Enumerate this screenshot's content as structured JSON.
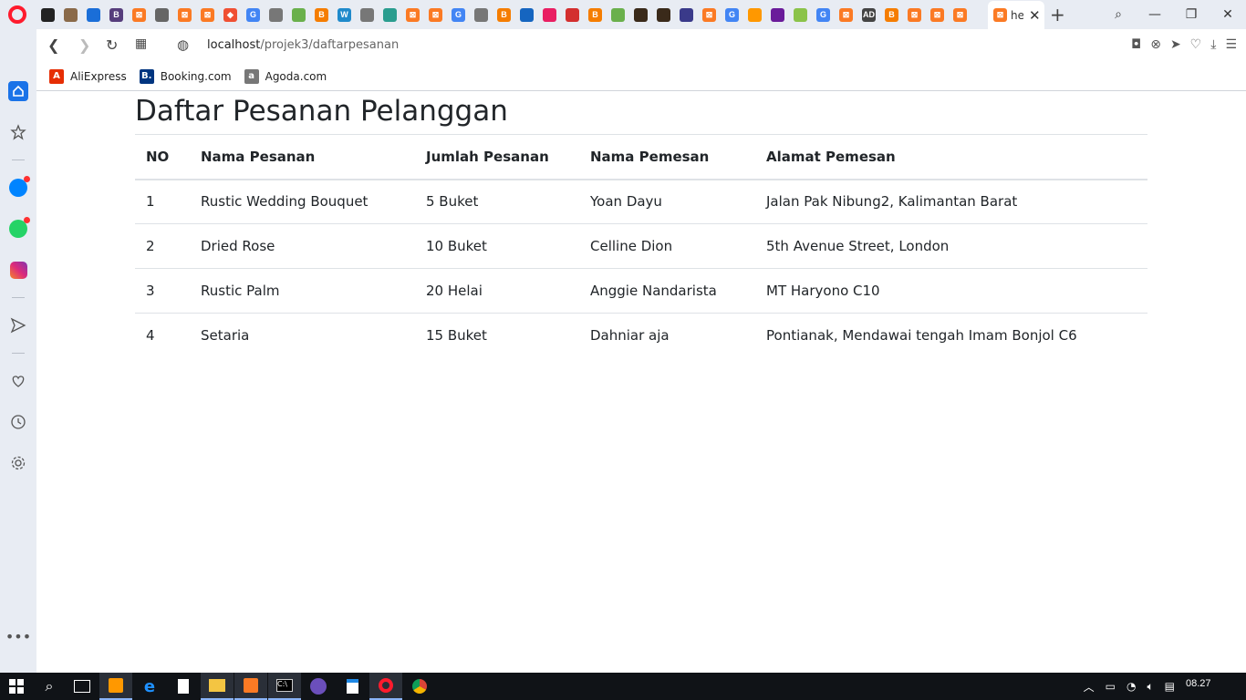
{
  "browser": {
    "active_tab_title": "he",
    "url_host": "localhost",
    "url_path": "/projek3/daftarpesanan",
    "tab_favicons": [
      {
        "name": "github-icon",
        "color": "#222",
        "glyph": ""
      },
      {
        "name": "avatar-icon",
        "color": "#8a6a4a",
        "glyph": ""
      },
      {
        "name": "flag-icon",
        "color": "#1a6ed8",
        "glyph": ""
      },
      {
        "name": "bootstrap-icon",
        "color": "#563d7c",
        "glyph": "B"
      },
      {
        "name": "xampp-icon",
        "color": "#fb7a24",
        "glyph": "⊠"
      },
      {
        "name": "grid-icon",
        "color": "#666",
        "glyph": ""
      },
      {
        "name": "xampp-icon",
        "color": "#fb7a24",
        "glyph": "⊠"
      },
      {
        "name": "xampp-icon",
        "color": "#fb7a24",
        "glyph": "⊠"
      },
      {
        "name": "git-icon",
        "color": "#f05033",
        "glyph": "◆"
      },
      {
        "name": "google-icon",
        "color": "#4285f4",
        "glyph": "G"
      },
      {
        "name": "doc-icon",
        "color": "#777",
        "glyph": ""
      },
      {
        "name": "leaf-icon",
        "color": "#6ab04c",
        "glyph": ""
      },
      {
        "name": "blogger-icon",
        "color": "#f57d00",
        "glyph": "B"
      },
      {
        "name": "w-icon",
        "color": "#1f8acb",
        "glyph": "W"
      },
      {
        "name": "doc-icon",
        "color": "#777",
        "glyph": ""
      },
      {
        "name": "pen-icon",
        "color": "#2a9d8f",
        "glyph": ""
      },
      {
        "name": "xampp-icon",
        "color": "#fb7a24",
        "glyph": "⊠"
      },
      {
        "name": "xampp-icon",
        "color": "#fb7a24",
        "glyph": "⊠"
      },
      {
        "name": "google-icon",
        "color": "#4285f4",
        "glyph": "G"
      },
      {
        "name": "doc-icon",
        "color": "#777",
        "glyph": ""
      },
      {
        "name": "blogger-icon",
        "color": "#f57d00",
        "glyph": "B"
      },
      {
        "name": "wave-icon",
        "color": "#1565c0",
        "glyph": ""
      },
      {
        "name": "color-icon",
        "color": "#e91e63",
        "glyph": ""
      },
      {
        "name": "record-icon",
        "color": "#d32f2f",
        "glyph": ""
      },
      {
        "name": "blogger-icon",
        "color": "#f57d00",
        "glyph": "B"
      },
      {
        "name": "leaf-icon",
        "color": "#6ab04c",
        "glyph": ""
      },
      {
        "name": "dark-icon",
        "color": "#3a2a1a",
        "glyph": ""
      },
      {
        "name": "dark-icon",
        "color": "#3a2a1a",
        "glyph": ""
      },
      {
        "name": "game-icon",
        "color": "#3a3a8a",
        "glyph": ""
      },
      {
        "name": "xampp-icon",
        "color": "#fb7a24",
        "glyph": "⊠"
      },
      {
        "name": "google-icon",
        "color": "#4285f4",
        "glyph": "G"
      },
      {
        "name": "note-icon",
        "color": "#ff9800",
        "glyph": ""
      },
      {
        "name": "colorlib-icon",
        "color": "#6a1b9a",
        "glyph": ""
      },
      {
        "name": "seal-icon",
        "color": "#8bc34a",
        "glyph": ""
      },
      {
        "name": "google-icon",
        "color": "#4285f4",
        "glyph": "G"
      },
      {
        "name": "xampp-icon",
        "color": "#fb7a24",
        "glyph": "⊠"
      },
      {
        "name": "ad-icon",
        "color": "#444",
        "glyph": "AD"
      },
      {
        "name": "blogger-icon",
        "color": "#f57d00",
        "glyph": "B"
      },
      {
        "name": "xampp-icon",
        "color": "#fb7a24",
        "glyph": "⊠"
      },
      {
        "name": "xampp-icon",
        "color": "#fb7a24",
        "glyph": "⊠"
      },
      {
        "name": "xampp-icon",
        "color": "#fb7a24",
        "glyph": "⊠"
      }
    ],
    "bookmarks": [
      {
        "label": "AliExpress",
        "icon": "aliexpress-icon",
        "color": "#e62e04",
        "glyph": "A"
      },
      {
        "label": "Booking.com",
        "icon": "booking-icon",
        "color": "#003580",
        "glyph": "B."
      },
      {
        "label": "Agoda.com",
        "icon": "agoda-icon",
        "color": "#777",
        "glyph": "a"
      }
    ]
  },
  "page": {
    "title": "Daftar Pesanan Pelanggan",
    "table": {
      "headers": [
        "NO",
        "Nama Pesanan",
        "Jumlah Pesanan",
        "Nama Pemesan",
        "Alamat Pemesan"
      ],
      "rows": [
        [
          "1",
          "Rustic Wedding Bouquet",
          "5 Buket",
          "Yoan Dayu",
          "Jalan Pak Nibung2, Kalimantan Barat"
        ],
        [
          "2",
          "Dried Rose",
          "10 Buket",
          "Celline Dion",
          "5th Avenue Street, London"
        ],
        [
          "3",
          "Rustic Palm",
          "20 Helai",
          "Anggie Nandarista",
          "MT Haryono C10"
        ],
        [
          "4",
          "Setaria",
          "15 Buket",
          "Dahniar aja",
          "Pontianak, Mendawai tengah Imam Bonjol C6"
        ]
      ]
    }
  },
  "taskbar": {
    "clock": "08.27"
  }
}
